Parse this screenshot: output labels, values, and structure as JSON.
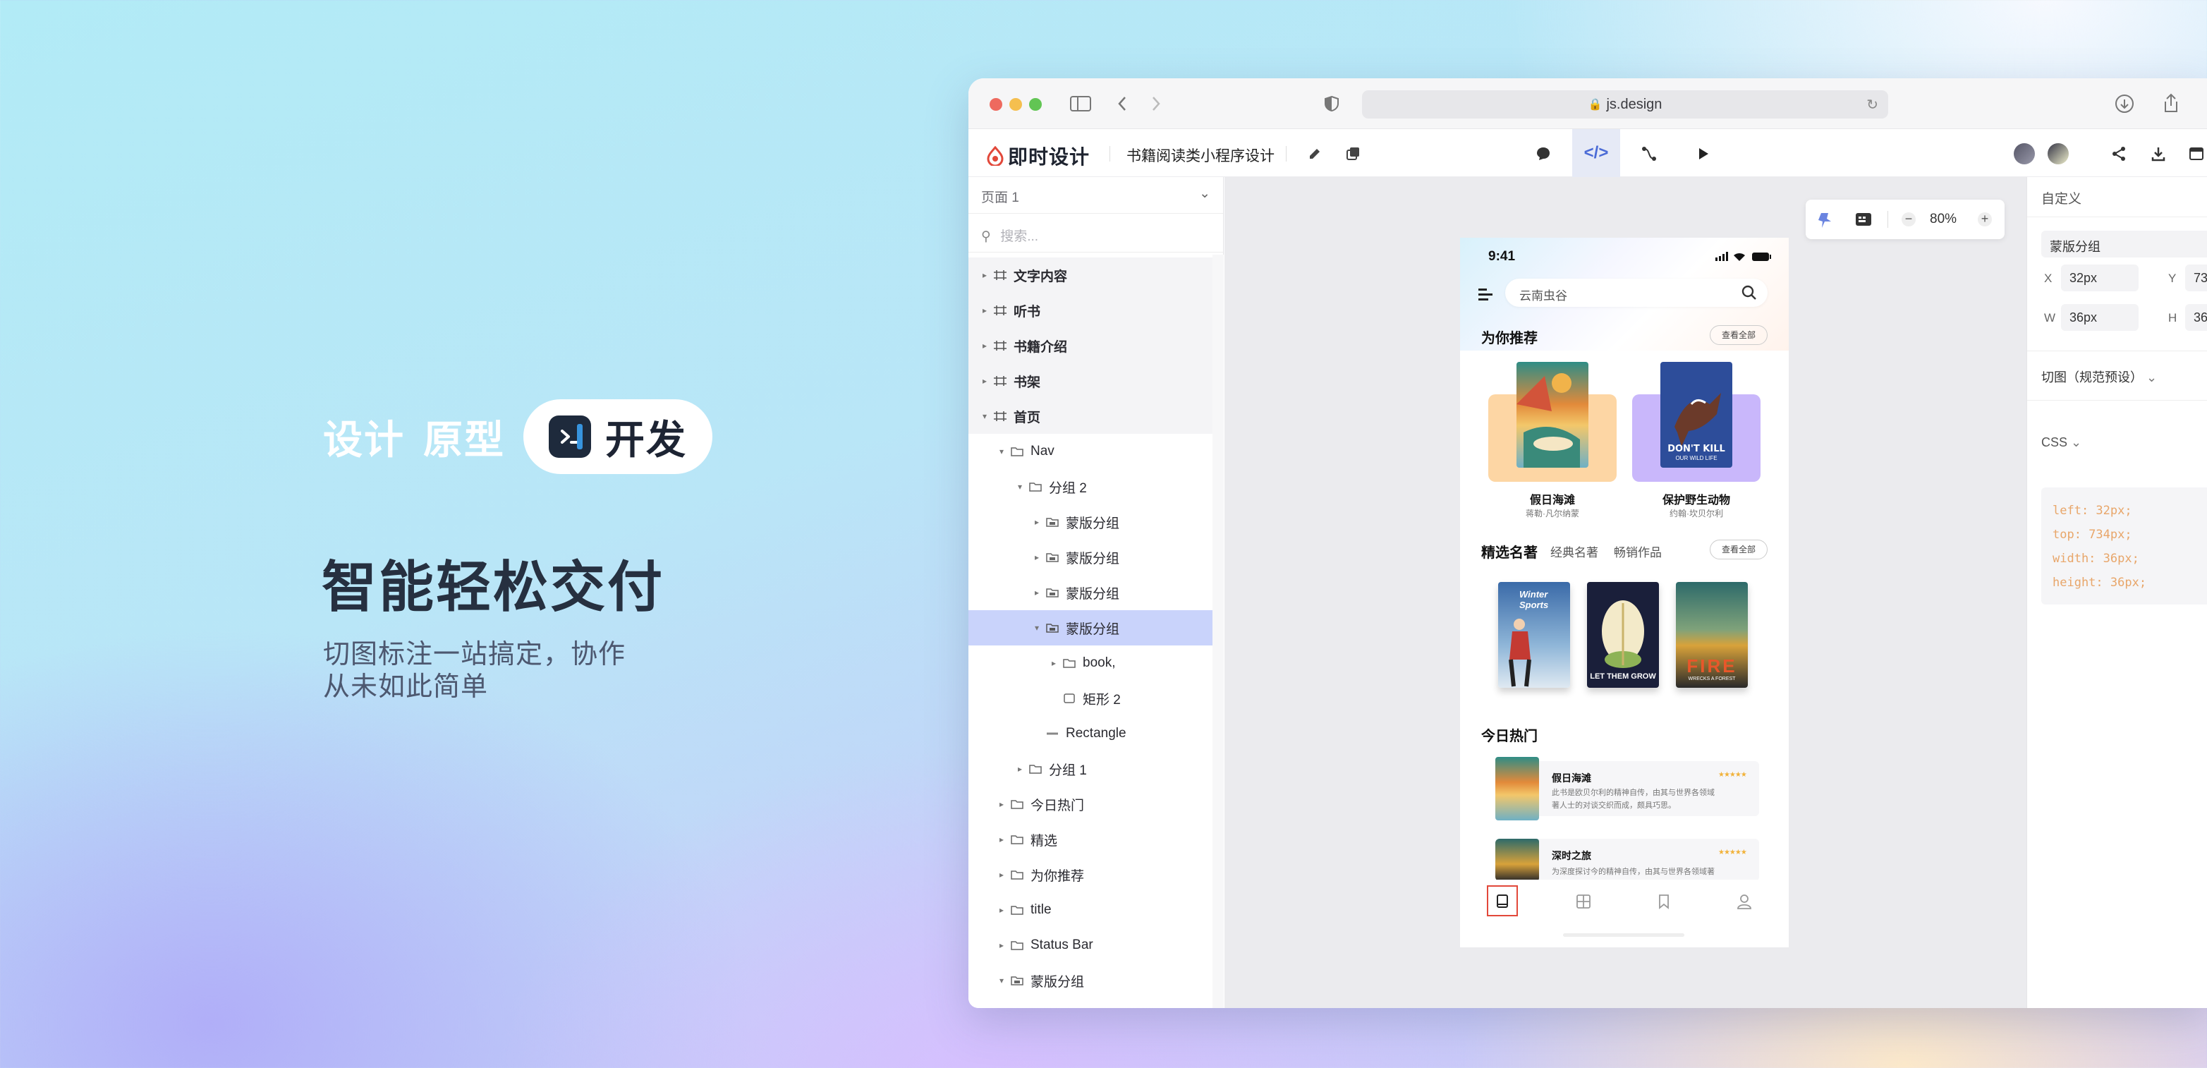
{
  "hero": {
    "word1": "设计",
    "word2": "原型",
    "pill_label": "开发",
    "headline": "智能轻松交付",
    "sub_line1": "切图标注一站搞定，协作",
    "sub_line2": "从未如此简单"
  },
  "browser": {
    "url": "js.design"
  },
  "app": {
    "logo_text": "即时设计",
    "project_name": "书籍阅读类小程序设计",
    "brand_color": "#e2483a",
    "dev_mode_label": "</>"
  },
  "layers": {
    "page_selector": "页面 1",
    "search_placeholder": "搜索...",
    "items": [
      {
        "label": "文字内容"
      },
      {
        "label": "听书"
      },
      {
        "label": "书籍介绍"
      },
      {
        "label": "书架"
      },
      {
        "label": "首页"
      },
      {
        "label": "Nav"
      },
      {
        "label": "分组 2"
      },
      {
        "label": "蒙版分组"
      },
      {
        "label": "蒙版分组"
      },
      {
        "label": "蒙版分组"
      },
      {
        "label": "蒙版分组"
      },
      {
        "label": "book,"
      },
      {
        "label": "矩形 2"
      },
      {
        "label": "Rectangle"
      },
      {
        "label": "分组 1"
      },
      {
        "label": "今日热门"
      },
      {
        "label": "精选"
      },
      {
        "label": "为你推荐"
      },
      {
        "label": "title"
      },
      {
        "label": "Status Bar"
      },
      {
        "label": "蒙版分组"
      }
    ]
  },
  "zoom": {
    "value": "80%"
  },
  "phone": {
    "time": "9:41",
    "search_text": "云南虫谷",
    "section_recommend": "为你推荐",
    "see_all": "查看全部",
    "rec_books": [
      {
        "title": "假日海滩",
        "author": "蒋勒·凡尔纳蒙"
      },
      {
        "title": "保护野生动物",
        "author": "约翰·坎贝尔利"
      }
    ],
    "poster_text": "DON'T KILL",
    "poster_sub": "OUR WILD LIFE",
    "section_classics": "精选名著",
    "tab_classics": "经典名著",
    "tab_bestseller": "畅销作品",
    "cover1_title": "Winter Sports",
    "cover2_title": "LET THEM GROW",
    "cover3_title": "FIRE",
    "cover3_sub": "WRECKS A FOREST",
    "section_hot": "今日热门",
    "hot_items": [
      {
        "title": "假日海滩",
        "stars": "★★★★★",
        "desc1": "此书是欧贝尔利的精神自传，由其与世界各领域",
        "desc2": "著人士的对谈交织而成，颇具巧思。"
      },
      {
        "title": "深时之旅",
        "stars": "★★★★★",
        "desc1": "为深度探讨今的精神自传，由其与世界各领域著"
      }
    ]
  },
  "inspector": {
    "title": "自定义",
    "layer_name": "蒙版分组",
    "x_label": "X",
    "x_value": "32px",
    "y_label": "Y",
    "y_value": "73",
    "w_label": "W",
    "w_value": "36px",
    "h_label": "H",
    "h_value": "36",
    "slice_label": "切图（规范预设）",
    "css_label": "CSS",
    "css_lines": [
      "left: 32px;",
      "top: 734px;",
      "width: 36px;",
      "height: 36px;"
    ]
  }
}
